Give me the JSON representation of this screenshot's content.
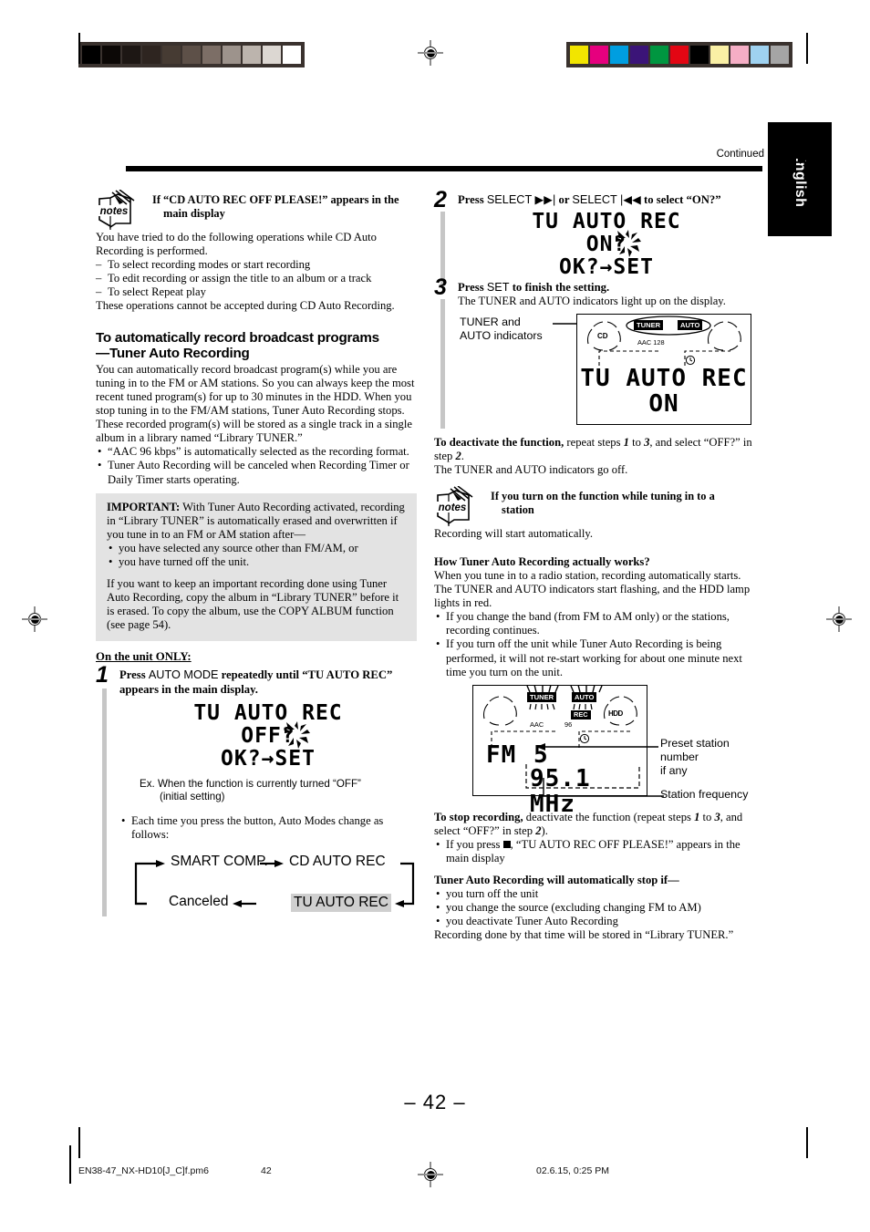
{
  "printer_marks": {
    "gray_bar_swatches": [
      "#000000",
      "#0c0806",
      "#1d1714",
      "#2e2520",
      "#463b33",
      "#5d5048",
      "#7c6e66",
      "#9d938c",
      "#bcb4ad",
      "#dcd7d2",
      "#ffffff"
    ],
    "color_bar_swatches": [
      "#f2e500",
      "#e6007e",
      "#009ee0",
      "#3b1478",
      "#009640",
      "#e30613",
      "#000000",
      "#faf0a5",
      "#f5aec5",
      "#9fd2f0",
      "#a5a5a5"
    ]
  },
  "header": {
    "continued_label": "Continued",
    "language_tab": "English"
  },
  "left_column": {
    "note1": {
      "icon": "notes-icon",
      "heading_line1": "If “CD AUTO REC OFF PLEASE!” appears in the",
      "heading_line2": "main display",
      "body": "You have tried to do the following operations while CD Auto Recording is performed.",
      "items": [
        "To select recording modes or start recording",
        "To edit recording or assign the title to an album or a track",
        "To select Repeat play"
      ],
      "footer": "These operations cannot be accepted during CD Auto Recording."
    },
    "section": {
      "heading_line1": "To automatically record broadcast programs",
      "heading_line2": "—Tuner Auto Recording",
      "para1": "You can automatically record broadcast program(s) while you are tuning in to the FM or AM stations. So you can always keep the most recent tuned program(s) for up to 30 minutes in the HDD. When you stop tuning in to the FM/AM stations, Tuner Auto Recording stops.",
      "para2": "These recorded program(s) will be stored as a single track in a single album in a library named “Library TUNER.”",
      "bullets": [
        "“AAC 96 kbps” is automatically selected as the recording format.",
        "Tuner Auto Recording will be canceled when Recording Timer or Daily Timer starts operating."
      ]
    },
    "important": {
      "label": "IMPORTANT:",
      "intro": " With Tuner Auto Recording activated, recording in “Library TUNER” is automatically erased and overwritten if you tune in to an FM or AM station after—",
      "bullets": [
        "you have selected any source other than FM/AM, or",
        "you have turned off the unit."
      ],
      "para2": "If you want to keep an important recording done using Tuner Auto Recording, copy the album in “Library TUNER” before it is erased. To copy the album, use the COPY ALBUM function (see page 54)."
    },
    "on_unit_only": "On the unit ONLY:",
    "step1": {
      "number": "1",
      "title_a": "Press ",
      "title_button": "AUTO MODE",
      "title_b": " repeatedly until “TU AUTO REC” appears in the main display.",
      "display_line1": "TU AUTO REC",
      "display_line2": "OFF?",
      "display_line3": "OK?→SET",
      "ex_line1": "Ex. When the function is currently turned “OFF”",
      "ex_line2": "(initial setting)",
      "bullet": "Each time you press the button, Auto Modes change as follows:",
      "cycle": {
        "item1": "SMART COMP.",
        "item2": "CD AUTO REC",
        "item3": "TU AUTO REC",
        "item4": "Canceled"
      }
    }
  },
  "right_column": {
    "step2": {
      "number": "2",
      "title_a": "Press ",
      "title_sel1": "SELECT ▶▶|",
      "title_mid": " or ",
      "title_sel2": "SELECT |◀◀",
      "title_b": " to select “ON?”",
      "display_line1": "TU AUTO REC",
      "display_line2": "ON?",
      "display_line3": "OK?→SET"
    },
    "step3": {
      "number": "3",
      "title_a": "Press ",
      "title_button": "SET",
      "title_b": " to finish the setting.",
      "sub": "The TUNER and AUTO indicators light up on the display.",
      "callout_line1": "TUNER and",
      "callout_line2": "AUTO indicators",
      "lcd": {
        "ind_cd": "CD",
        "ind_tuner": "TUNER",
        "ind_auto": "AUTO",
        "codec": "AAC 128",
        "main_line1": "TU AUTO REC",
        "main_line2": "ON"
      }
    },
    "deactivate": {
      "bold": "To deactivate the function,",
      "rest": " repeat steps ",
      "step_a": "1",
      "to": " to ",
      "step_b": "3",
      "rest2": ", and select “OFF?” in step ",
      "step_c": "2",
      "period": ".",
      "line2": "The TUNER and AUTO indicators go off."
    },
    "note2": {
      "icon": "notes-icon",
      "heading_line1": "If you turn on the function while tuning in to a",
      "heading_line2": "station",
      "body": "Recording will start automatically."
    },
    "how_works": {
      "heading": "How Tuner Auto Recording actually works?",
      "para1": "When you tune in to a radio station, recording automatically starts.",
      "para2": "The TUNER and AUTO indicators start flashing, and the HDD lamp lights in red.",
      "bullets": [
        "If you change the band (from FM to AM only) or the stations, recording continues.",
        "If you turn off the unit while Tuner Auto Recording is being performed, it will not re-start working for about one minute next time you turn on the unit."
      ]
    },
    "lcd2": {
      "ind_tuner": "TUNER",
      "ind_auto": "AUTO",
      "ind_rec": "REC",
      "ind_hdd": "HDD",
      "codec_a": "AAC",
      "codec_b": "96",
      "main_line1_a": "FM",
      "main_line1_b": "5",
      "main_line2": "95.1 MHz",
      "callout1_line1": "Preset station number",
      "callout1_line2": "if any",
      "callout2": "Station frequency"
    },
    "stop_recording": {
      "bold": "To stop recording,",
      "rest": " deactivate the function (repeat steps ",
      "step_a": "1",
      "to": " to ",
      "step_b": "3",
      "rest2": ", and select “OFF?” in step ",
      "step_c": "2",
      "close": ").",
      "bullet_a": "If you press ",
      "bullet_b": ", “TU AUTO REC OFF PLEASE!” appears in the main display"
    },
    "auto_stop": {
      "heading": "Tuner Auto Recording will automatically stop if—",
      "bullets": [
        "you turn off the unit",
        "you change the source (excluding changing FM to AM)",
        "you deactivate Tuner Auto Recording"
      ],
      "footer": "Recording done by that time will be stored in “Library TUNER.”"
    }
  },
  "footer": {
    "page_number": "– 42 –",
    "file_name": "EN38-47_NX-HD10[J_C]f.pm6",
    "page_index": "42",
    "timestamp": "02.6.15, 0:25 PM"
  }
}
